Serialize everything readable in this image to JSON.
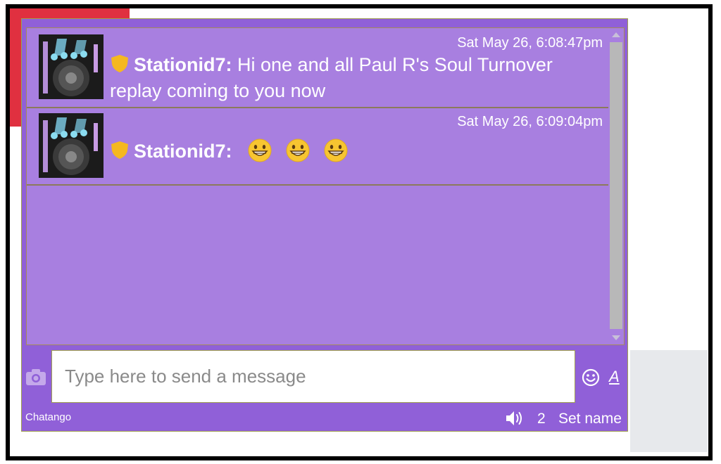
{
  "messages": [
    {
      "timestamp": "Sat May 26, 6:08:47pm",
      "username": "Stationid7:",
      "text": " Hi one and all Paul R's Soul Turnover replay coming to you now"
    },
    {
      "timestamp": "Sat May 26, 6:09:04pm",
      "username": "Stationid7:",
      "emoji_count": 3,
      "emoji": "grinning-face-icon"
    }
  ],
  "input": {
    "placeholder": "Type here to send a message"
  },
  "footer": {
    "brand": "Chatango",
    "user_count": "2",
    "set_name": "Set name"
  },
  "toolbar": {
    "font_label": "A"
  },
  "colors": {
    "chat_bg": "#9060d8",
    "message_area": "#a87fe0",
    "badge": "#f5b820",
    "corner_accent": "#e03040"
  }
}
